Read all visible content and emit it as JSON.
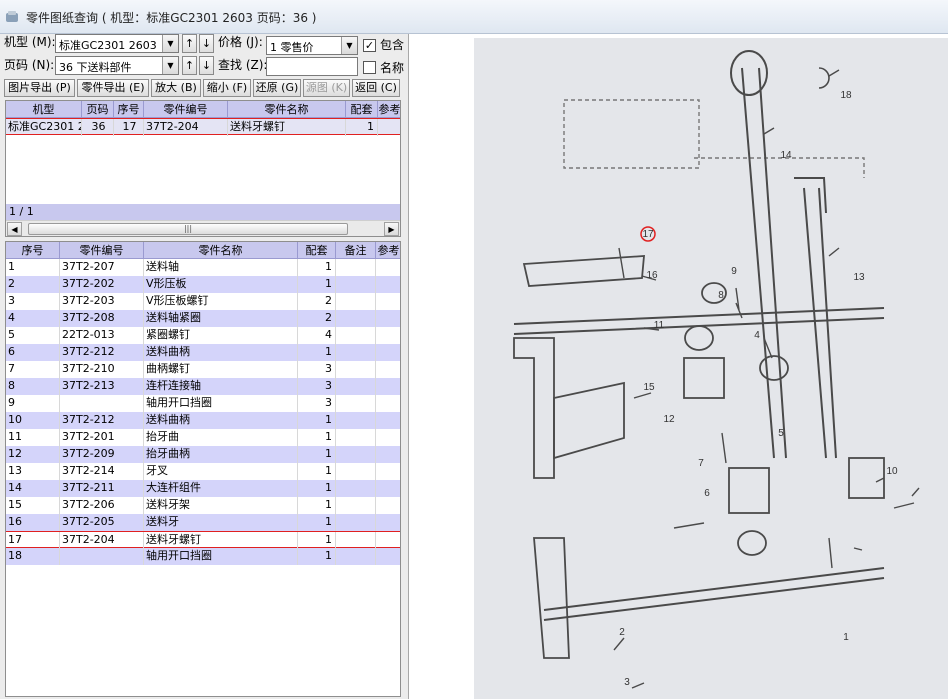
{
  "window": {
    "title": "零件图纸查询 ( 机型：标准GC2301 2603 页码：36 )"
  },
  "filters": {
    "model_label": "机型 (M):",
    "model_value": "标准GC2301 2603",
    "page_label": "页码 (N):",
    "page_value": "36 下送料部件",
    "price_label": "价格 (J):",
    "price_value": "1    零售价",
    "find_label": "查找 (Z):",
    "find_value": "",
    "include_label": "包含",
    "include_checked": true,
    "name_label": "名称",
    "name_checked": false,
    "up_arrow": "↑",
    "down_arrow": "↓"
  },
  "toolbar": {
    "export_image": "图片导出 (P)",
    "export_part": "零件导出 (E)",
    "zoom_in": "放大 (B)",
    "zoom_out": "缩小 (F)",
    "restore": "还原 (G)",
    "original": "源图 (K)",
    "back": "返回 (C)"
  },
  "top_table": {
    "headers": [
      "机型",
      "页码",
      "序号",
      "零件编号",
      "零件名称",
      "配套",
      "参考"
    ],
    "rows": [
      {
        "model": "标准GC2301 2",
        "page": "36",
        "seq": "17",
        "code": "37T2-204",
        "name": "送料牙螺钉",
        "qty": "1"
      }
    ],
    "pager": "1 / 1"
  },
  "parts_table": {
    "headers": [
      "序号",
      "零件编号",
      "零件名称",
      "配套",
      "备注",
      "参考"
    ],
    "selected_seq": "17",
    "rows": [
      {
        "seq": "1",
        "code": "37T2-207",
        "name": "送料轴",
        "qty": "1"
      },
      {
        "seq": "2",
        "code": "37T2-202",
        "name": "V形压板",
        "qty": "1"
      },
      {
        "seq": "3",
        "code": "37T2-203",
        "name": "V形压板螺钉",
        "qty": "2"
      },
      {
        "seq": "4",
        "code": "37T2-208",
        "name": "送料轴紧圈",
        "qty": "2"
      },
      {
        "seq": "5",
        "code": "22T2-013",
        "name": "紧圈螺钉",
        "qty": "4"
      },
      {
        "seq": "6",
        "code": "37T2-212",
        "name": "送料曲柄",
        "qty": "1"
      },
      {
        "seq": "7",
        "code": "37T2-210",
        "name": "曲柄螺钉",
        "qty": "3"
      },
      {
        "seq": "8",
        "code": "37T2-213",
        "name": "连杆连接轴",
        "qty": "3"
      },
      {
        "seq": "9",
        "code": "",
        "name": "轴用开口挡圈",
        "qty": "3"
      },
      {
        "seq": "10",
        "code": "37T2-212",
        "name": "送料曲柄",
        "qty": "1"
      },
      {
        "seq": "11",
        "code": "37T2-201",
        "name": "抬牙曲",
        "qty": "1"
      },
      {
        "seq": "12",
        "code": "37T2-209",
        "name": "抬牙曲柄",
        "qty": "1"
      },
      {
        "seq": "13",
        "code": "37T2-214",
        "name": "牙叉",
        "qty": "1"
      },
      {
        "seq": "14",
        "code": "37T2-211",
        "name": "大连杆组件",
        "qty": "1"
      },
      {
        "seq": "15",
        "code": "37T2-206",
        "name": "送料牙架",
        "qty": "1"
      },
      {
        "seq": "16",
        "code": "37T2-205",
        "name": "送料牙",
        "qty": "1"
      },
      {
        "seq": "17",
        "code": "37T2-204",
        "name": "送料牙螺钉",
        "qty": "1"
      },
      {
        "seq": "18",
        "code": "",
        "name": "轴用开口挡圈",
        "qty": "1"
      }
    ]
  },
  "diagram": {
    "callouts": [
      "1",
      "2",
      "3",
      "4",
      "5",
      "6",
      "7",
      "8",
      "9",
      "10",
      "11",
      "12",
      "13",
      "14",
      "15",
      "16",
      "17",
      "18"
    ],
    "highlighted": "17"
  },
  "colors": {
    "alt_row": "#d4d4fa",
    "header": "#c8c8ee",
    "selection": "#e02020"
  }
}
